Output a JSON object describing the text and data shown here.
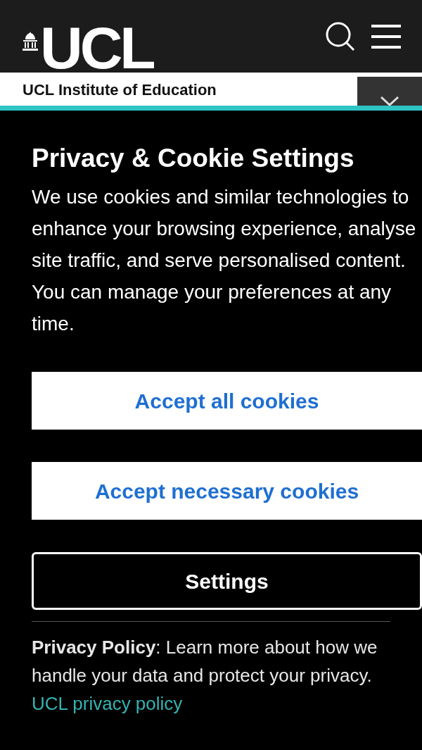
{
  "header": {
    "logo": "UCL"
  },
  "subheader": {
    "title": "UCL Institute of Education"
  },
  "cookie_banner": {
    "title": "Privacy & Cookie Settings",
    "description": "We use cookies and similar technologies to enhance your browsing experience, analyse site traffic, and serve personalised content. You can manage your preferences at any time.",
    "buttons": [
      {
        "label": "Accept all cookies",
        "kind": "primary"
      },
      {
        "label": "Accept necessary cookies",
        "kind": "primary"
      },
      {
        "label": "Settings",
        "kind": "outline"
      }
    ],
    "privacy_note": "**Privacy Policy**: Learn more about how we handle your data and protect your privacy.",
    "privacy_link": "UCL privacy policy"
  }
}
